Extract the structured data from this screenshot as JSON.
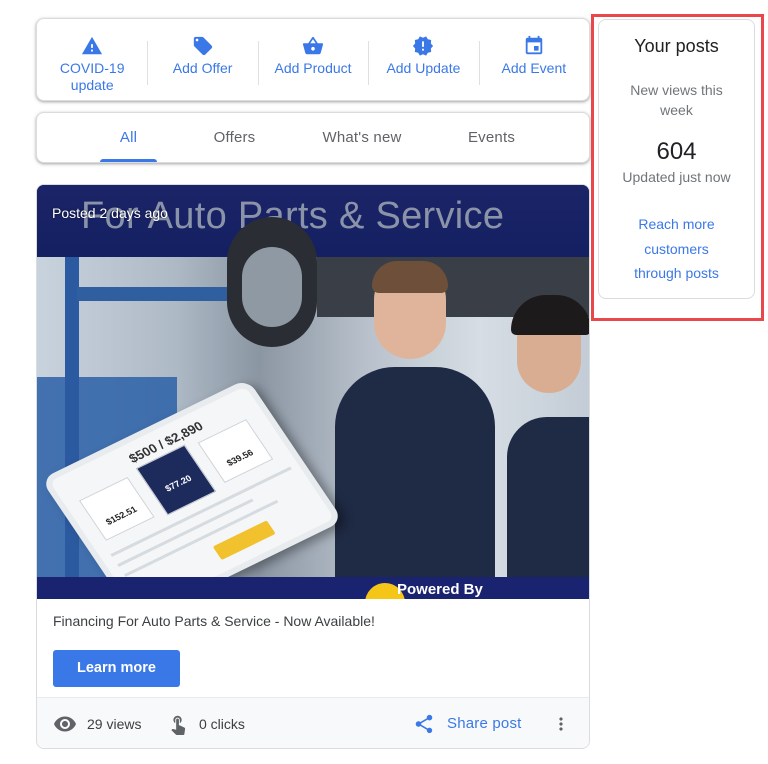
{
  "actions": [
    {
      "label": "COVID-19 update",
      "icon": "warning-icon"
    },
    {
      "label": "Add Offer",
      "icon": "tag-icon"
    },
    {
      "label": "Add Product",
      "icon": "basket-icon"
    },
    {
      "label": "Add Update",
      "icon": "alert-badge-icon"
    },
    {
      "label": "Add Event",
      "icon": "calendar-icon"
    }
  ],
  "tabs": [
    {
      "label": "All",
      "active": true
    },
    {
      "label": "Offers",
      "active": false
    },
    {
      "label": "What's new",
      "active": false
    },
    {
      "label": "Events",
      "active": false
    }
  ],
  "post": {
    "posted": "Posted 2 days ago",
    "image_headline": "For Auto Parts & Service",
    "image_footer": "Powered By",
    "tablet_price": "$500 / $2,890",
    "tablet_options": [
      "$152.51",
      "$77.20",
      "$39.56"
    ],
    "text": "Financing For Auto Parts & Service - Now Available!",
    "cta_label": "Learn more",
    "views": "29 views",
    "clicks": "0 clicks",
    "share_label": "Share post"
  },
  "your_posts": {
    "title": "Your posts",
    "subtitle": "New views this week",
    "count": "604",
    "updated": "Updated just now",
    "link": "Reach more customers through posts"
  },
  "colors": {
    "accent": "#3b78e7",
    "highlight": "#e8474b",
    "banner": "#1b2466"
  }
}
